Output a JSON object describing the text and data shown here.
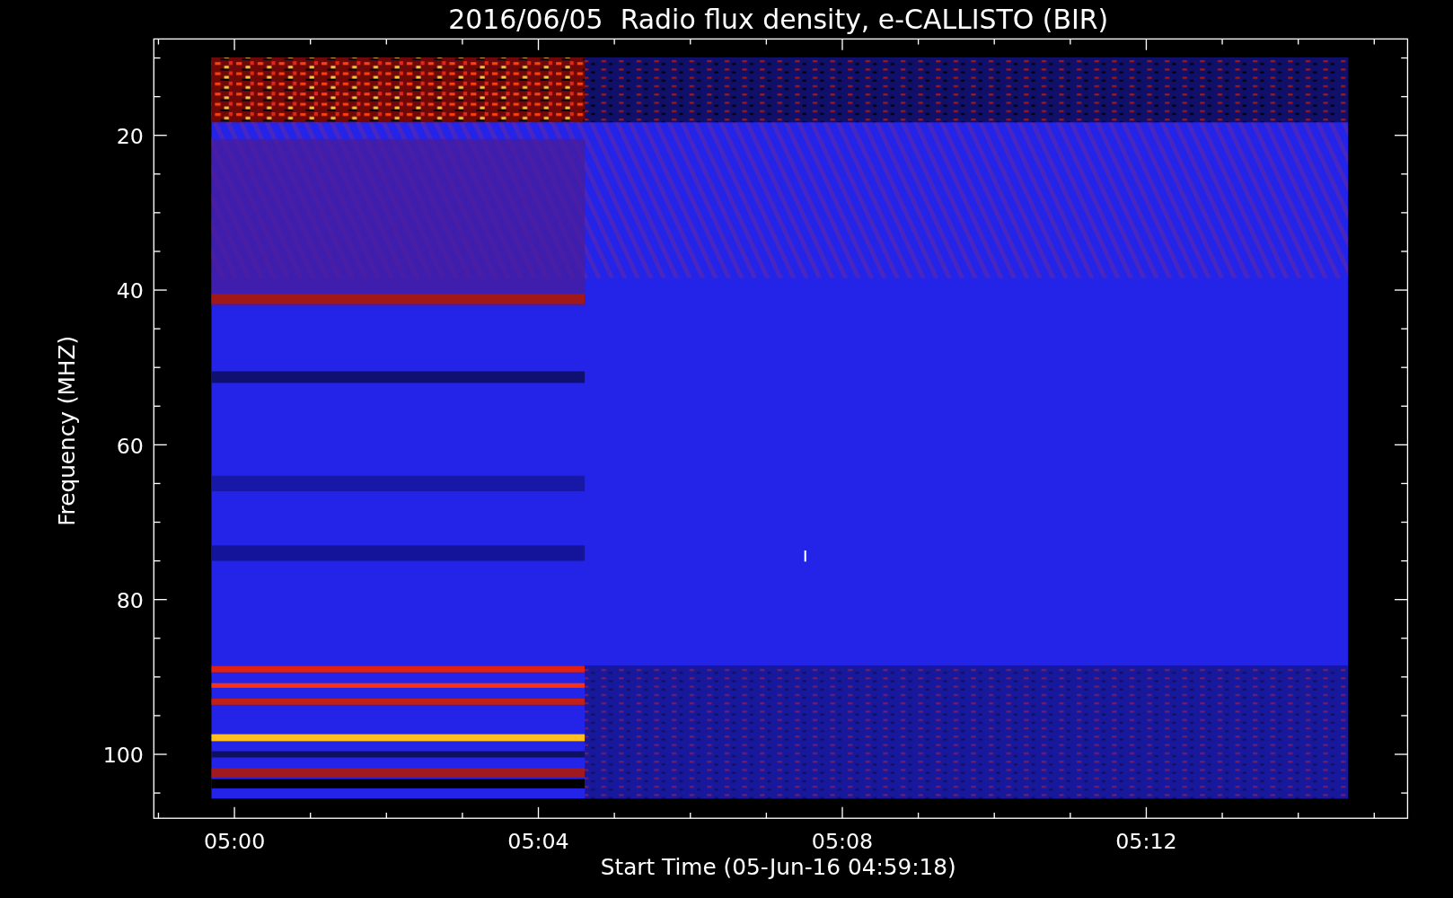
{
  "title": "2016/06/05  Radio flux density, e-CALLISTO (BIR)",
  "y_axis": {
    "label": "Frequency (MHZ)",
    "tick_labels": [
      "20",
      "40",
      "60",
      "80",
      "100"
    ]
  },
  "x_axis": {
    "label": "Start Time (05-Jun-16 04:59:18)",
    "tick_labels": [
      "05:00",
      "05:04",
      "05:08",
      "05:12"
    ]
  }
}
